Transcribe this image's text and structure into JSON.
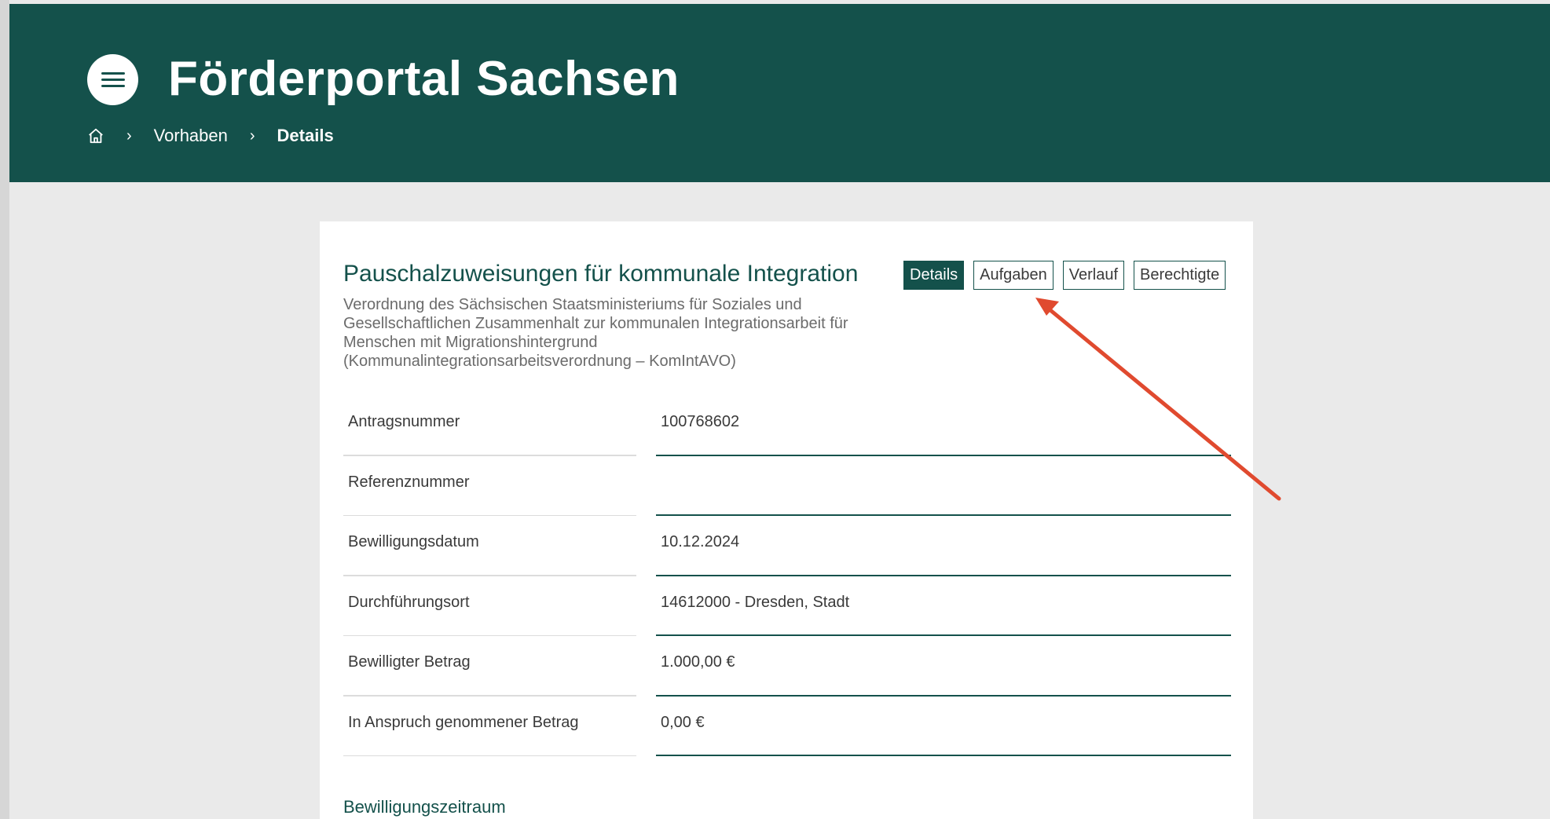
{
  "header": {
    "app_title": "Förderportal Sachsen",
    "breadcrumb": {
      "home_icon": "home-icon",
      "items": [
        "Vorhaben",
        "Details"
      ]
    }
  },
  "card": {
    "title": "Pauschalzuweisungen für kommunale Integration",
    "description_lines": [
      "Verordnung des Sächsischen Staatsministeriums für Soziales und",
      "Gesellschaftlichen Zusammenhalt zur kommunalen Integrationsarbeit für",
      "Menschen mit Migrationshintergrund",
      "(Kommunalintegrationsarbeitsverordnung – KomIntAVO)"
    ],
    "tabs": [
      "Details",
      "Aufgaben",
      "Verlauf",
      "Berechtigte"
    ],
    "active_tab": "Details",
    "fields": [
      {
        "label": "Antragsnummer",
        "value": "100768602"
      },
      {
        "label": "Referenznummer",
        "value": ""
      },
      {
        "label": "Bewilligungsdatum",
        "value": "10.12.2024"
      },
      {
        "label": "Durchführungsort",
        "value": "14612000 - Dresden, Stadt"
      },
      {
        "label": "Bewilligter Betrag",
        "value": "1.000,00 €"
      },
      {
        "label": "In Anspruch genommener Betrag",
        "value": "0,00 €"
      }
    ],
    "section_title": "Bewilligungszeitraum"
  },
  "colors": {
    "brand": "#14514b",
    "annotation_arrow": "#e04a2f"
  }
}
